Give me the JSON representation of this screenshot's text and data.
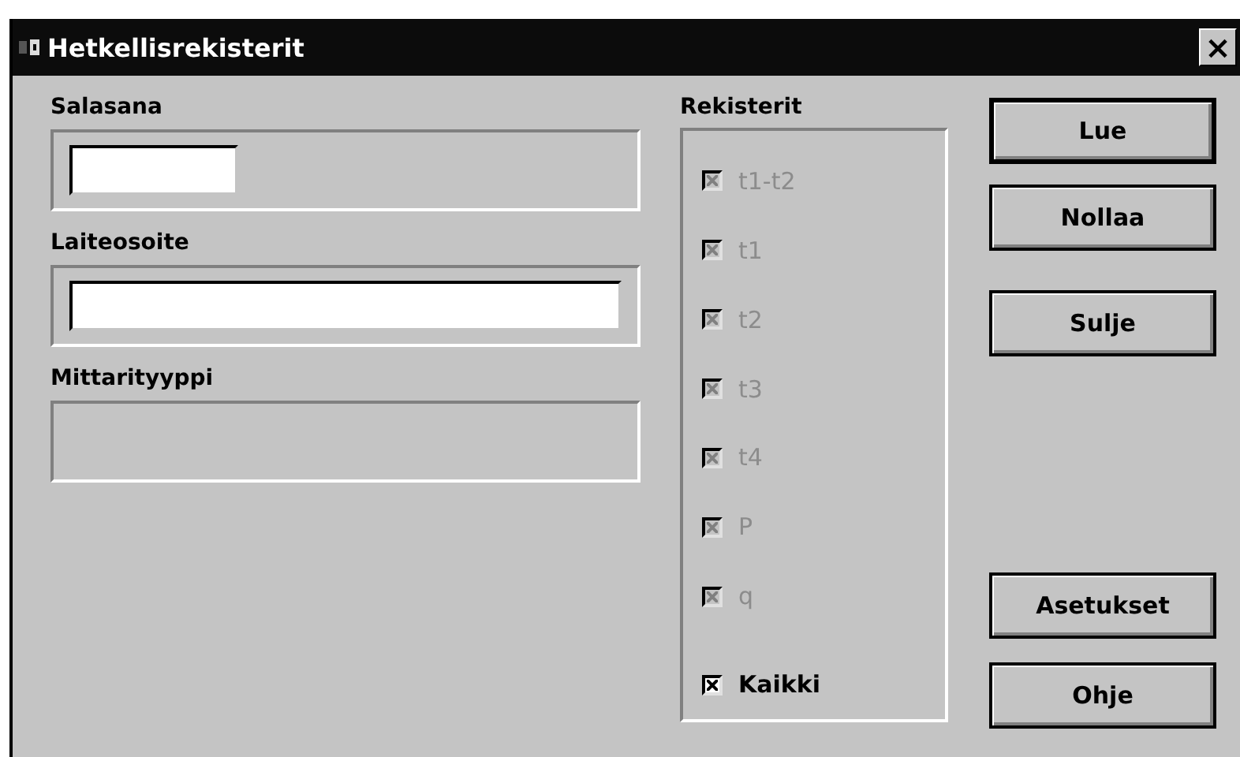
{
  "window": {
    "title": "Hetkellisrekisterit",
    "close": "×"
  },
  "fields": [
    {
      "label": "Salasana",
      "kind": "short-input"
    },
    {
      "label": "Laiteosoite",
      "kind": "long-input"
    },
    {
      "label": "Mittarityyppi",
      "kind": "empty"
    }
  ],
  "registers": {
    "title": "Rekisterit",
    "items": [
      {
        "label": "t1-t2",
        "checked": true,
        "disabled": true
      },
      {
        "label": "t1",
        "checked": true,
        "disabled": true
      },
      {
        "label": "t2",
        "checked": true,
        "disabled": true
      },
      {
        "label": "t3",
        "checked": true,
        "disabled": true
      },
      {
        "label": "t4",
        "checked": true,
        "disabled": true
      },
      {
        "label": "P",
        "checked": true,
        "disabled": true
      },
      {
        "label": "q",
        "checked": true,
        "disabled": true
      },
      {
        "label": "Kaikki",
        "checked": true,
        "disabled": false
      }
    ]
  },
  "buttons": [
    {
      "label": "Lue",
      "default": true,
      "kind": "top"
    },
    {
      "label": "Nollaa",
      "default": false,
      "kind": "top"
    },
    {
      "label": "Sulje",
      "default": false,
      "kind": "top"
    },
    {
      "label": "Asetukset",
      "default": false,
      "kind": "bottom"
    },
    {
      "label": "Ohje",
      "default": false,
      "kind": "bottom"
    }
  ]
}
